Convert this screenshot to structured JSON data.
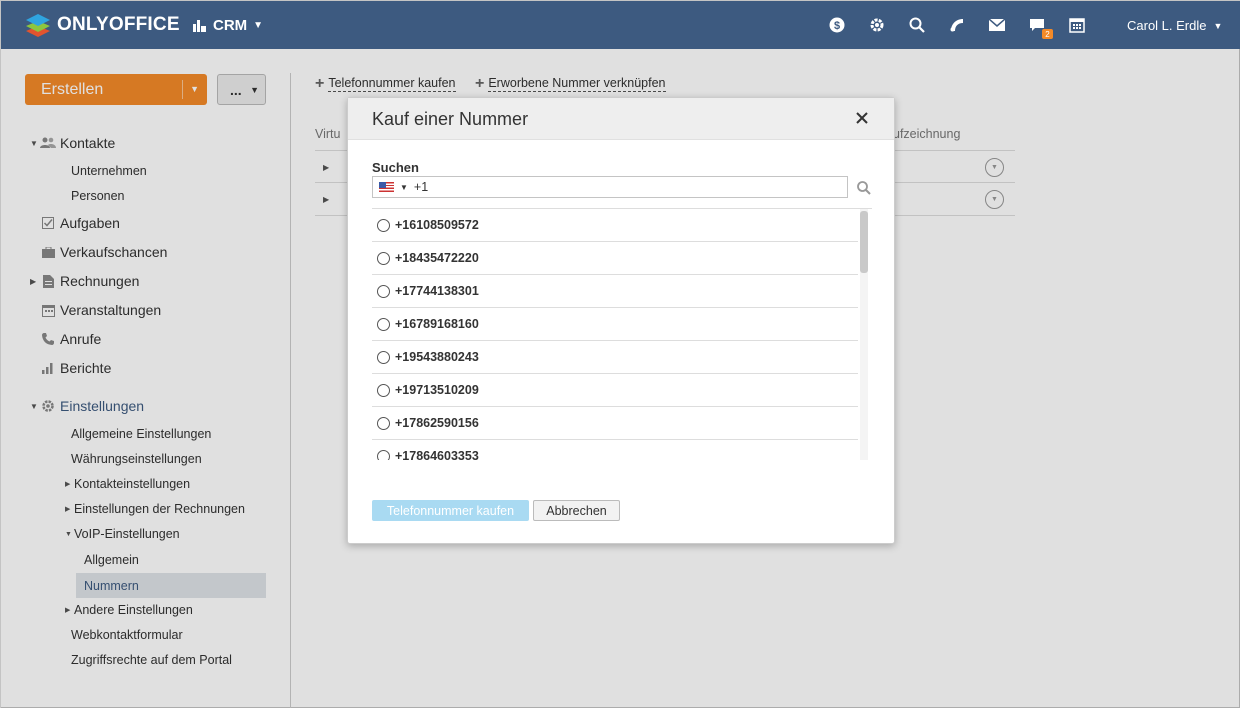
{
  "app": {
    "logo_text": "ONLYOFFICE",
    "module_label": "CRM",
    "user_name": "Carol L. Erdle",
    "chat_badge": "2",
    "brand_color": "#3d5a80",
    "accent_color": "#f48a28",
    "top_icons": [
      "dollar-icon",
      "gear-icon",
      "search-icon",
      "feed-icon",
      "mail-icon",
      "chat-icon",
      "calendar-icon"
    ]
  },
  "sidebar": {
    "create_button": "Erstellen",
    "more_button": "...",
    "items": [
      {
        "label": "Kontakte",
        "icon": "contacts-icon"
      },
      {
        "label": "Unternehmen"
      },
      {
        "label": "Personen"
      },
      {
        "label": "Aufgaben",
        "icon": "tasks-icon"
      },
      {
        "label": "Verkaufschancen",
        "icon": "briefcase-icon"
      },
      {
        "label": "Rechnungen",
        "icon": "invoice-icon"
      },
      {
        "label": "Veranstaltungen",
        "icon": "calendar-icon"
      },
      {
        "label": "Anrufe",
        "icon": "phone-icon"
      },
      {
        "label": "Berichte",
        "icon": "reports-icon"
      },
      {
        "label": "Einstellungen",
        "icon": "gear-icon"
      }
    ],
    "settings_items": [
      {
        "label": "Allgemeine Einstellungen"
      },
      {
        "label": "Währungseinstellungen"
      },
      {
        "label": "Kontakteinstellungen"
      },
      {
        "label": "Einstellungen der Rechnungen"
      },
      {
        "label": "VoIP-Einstellungen"
      },
      {
        "label": "Allgemein"
      },
      {
        "label": "Nummern"
      },
      {
        "label": "Andere Einstellungen"
      },
      {
        "label": "Webkontaktformular"
      },
      {
        "label": "Zugriffsrechte auf dem Portal"
      }
    ]
  },
  "content": {
    "buy_link": "Telefonnummer kaufen",
    "link_link": "Erworbene Nummer verknüpfen",
    "col_virtual": "Virtu",
    "col_recording": "ufzeichnung"
  },
  "dialog": {
    "title": "Kauf einer Nummer",
    "search_label": "Suchen",
    "search_value": "+1",
    "numbers": [
      "+16108509572",
      "+18435472220",
      "+17744138301",
      "+16789168160",
      "+19543880243",
      "+19713510209",
      "+17862590156",
      "+17864603353"
    ],
    "buy_button": "Telefonnummer kaufen",
    "cancel_button": "Abbrechen"
  }
}
